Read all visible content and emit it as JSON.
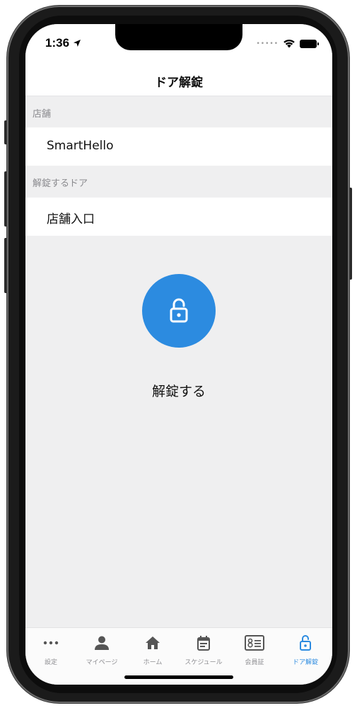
{
  "status_bar": {
    "time": "1:36"
  },
  "nav": {
    "title": "ドア解錠"
  },
  "store_section": {
    "header": "店舗",
    "value": "SmartHello"
  },
  "door_section": {
    "header": "解錠するドア",
    "value": "店舗入口"
  },
  "unlock": {
    "label": "解錠する",
    "icon": "lock-open-icon",
    "color": "#2c8be0"
  },
  "tabs": [
    {
      "label": "設定",
      "icon": "more-dots-icon",
      "active": false
    },
    {
      "label": "マイページ",
      "icon": "person-icon",
      "active": false
    },
    {
      "label": "ホーム",
      "icon": "home-icon",
      "active": false
    },
    {
      "label": "スケジュール",
      "icon": "calendar-icon",
      "active": false
    },
    {
      "label": "会員証",
      "icon": "member-card-icon",
      "active": false
    },
    {
      "label": "ドア解錠",
      "icon": "lock-open-icon",
      "active": true
    }
  ],
  "colors": {
    "accent": "#2c8be0",
    "tab_inactive": "#8e8e92",
    "background": "#efeff0"
  }
}
